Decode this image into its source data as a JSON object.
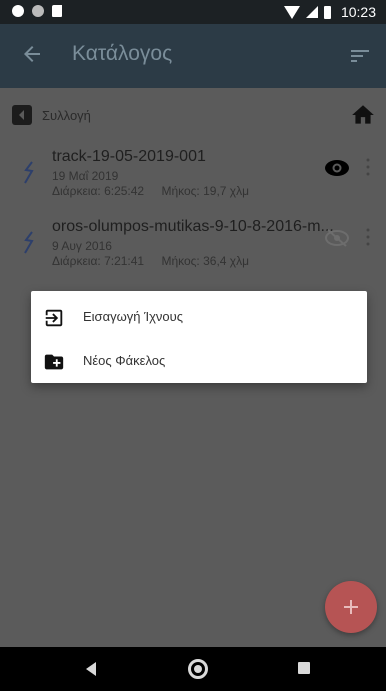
{
  "status_bar": {
    "time": "10:23"
  },
  "app_bar": {
    "title": "Κατάλογος",
    "back_icon": "arrow-left-icon",
    "sort_icon": "sort-icon"
  },
  "breadcrumb": {
    "label": "Συλλογή",
    "back_icon": "back-box-icon",
    "home_icon": "home-icon"
  },
  "tracks": [
    {
      "name": "track-19-05-2019-001",
      "date": "19 Μαΐ 2019",
      "duration": "Διάρκεια: 6:25:42",
      "length": "Μήκος: 19,7 χλμ",
      "visible": true
    },
    {
      "name": "oros-olumpos-mutikas-9-10-8-2016-m...",
      "date": "9 Αυγ 2016",
      "duration": "Διάρκεια: 7:21:41",
      "length": "Μήκος: 36,4 χλμ",
      "visible": false
    }
  ],
  "menu": {
    "items": [
      {
        "label": "Εισαγωγή Ίχνους",
        "icon": "import-icon"
      },
      {
        "label": "Νέος Φάκελος",
        "icon": "new-folder-icon"
      }
    ]
  },
  "fab": {
    "icon": "plus-icon"
  },
  "colors": {
    "status_bar": "#1c2124",
    "app_bar": "#2c3b46",
    "fab": "#b65454",
    "scrim": "#5b5b5b"
  }
}
